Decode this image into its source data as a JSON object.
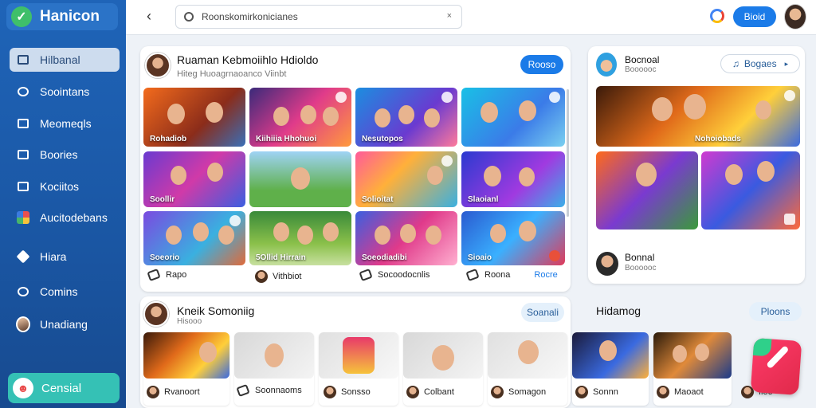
{
  "sidebar": {
    "logo": "Hanicon",
    "items": [
      {
        "label": "Hilbanal",
        "icon": "dashboard-icon"
      },
      {
        "label": "Soointans",
        "icon": "people-icon"
      },
      {
        "label": "Meomeqls",
        "icon": "messages-icon"
      },
      {
        "label": "Boories",
        "icon": "stories-icon"
      },
      {
        "label": "Kociitos",
        "icon": "document-icon"
      },
      {
        "label": "Aucitodebans",
        "icon": "apps-icon"
      },
      {
        "label": "Hiara",
        "icon": "pin-icon"
      },
      {
        "label": "Comins",
        "icon": "comments-icon"
      },
      {
        "label": "Unadiang",
        "icon": "avatar-icon"
      }
    ],
    "bottom_button": "Censial"
  },
  "topbar": {
    "search_value": "Roonskomirkonicianes",
    "clear": "×",
    "sign_button": "Bioid"
  },
  "panel_main": {
    "title": "Ruaman Kebmoiihlo Hdioldo",
    "subtitle": "Hiteg Huoagrnaoanco Viinbt",
    "button": "Rooso",
    "thumbs": [
      {
        "caption": "Rohadiob"
      },
      {
        "caption": "Kiihiiia Hhohuoi"
      },
      {
        "caption": "Nesutopos"
      },
      {
        "caption": ""
      },
      {
        "caption": "Soollir"
      },
      {
        "caption": ""
      },
      {
        "caption": "Solioitat"
      },
      {
        "caption": "Slaoianl"
      },
      {
        "caption": "Soeorio"
      },
      {
        "caption": "5Ollid Hirrain"
      },
      {
        "caption": "Soeodiadibi"
      },
      {
        "caption": "Sioaio"
      }
    ],
    "footer": [
      {
        "label": "Rapo"
      },
      {
        "label": "Vithbiot"
      },
      {
        "label": "Socoodocnlis"
      },
      {
        "label": "Roona",
        "link": "Rocre"
      }
    ]
  },
  "panel_side": {
    "title": "Bocnoal",
    "subtitle": "Boooooc",
    "dropdown": "Bogaes",
    "hero_caption": "Nohoiobads",
    "footer_title": "Bonnal",
    "footer_sub": "Boooooc"
  },
  "panel_bottom_left": {
    "title": "Kneik Somoniig",
    "subtitle": "Hisooo",
    "button": "Soanali"
  },
  "panel_bottom_right": {
    "title": "Hidamog",
    "button": "Ploons"
  },
  "strip_cards": [
    {
      "label": "Rvanoort"
    },
    {
      "label": "Soonnaoms"
    },
    {
      "label": "Sonsso"
    },
    {
      "label": "Colbant"
    },
    {
      "label": "Somagon"
    },
    {
      "label": "Sonnn"
    },
    {
      "label": "Maoaot"
    },
    {
      "label": "Iloo"
    }
  ]
}
